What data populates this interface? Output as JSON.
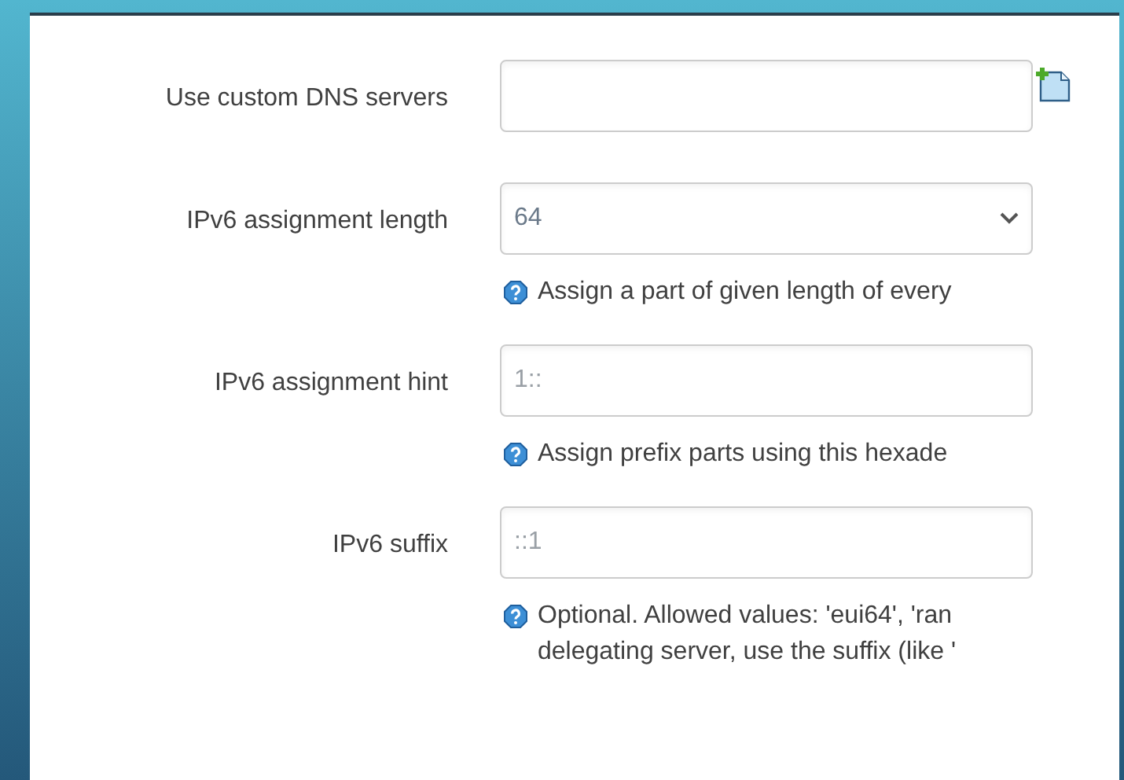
{
  "fields": [
    {
      "kind": "dynlist",
      "label": "Use custom DNS servers"
    },
    {
      "kind": "select",
      "label": "IPv6 assignment length",
      "value": "64",
      "hint": [
        "Assign a part of given length of every"
      ]
    },
    {
      "kind": "text",
      "label": "IPv6 assignment hint",
      "placeholder": "1::",
      "hint": [
        "Assign prefix parts using this hexade"
      ]
    },
    {
      "kind": "text",
      "label": "IPv6 suffix",
      "placeholder": "::1",
      "hint": [
        "Optional. Allowed values: 'eui64', 'ran",
        "delegating server, use the suffix (like '"
      ]
    }
  ]
}
